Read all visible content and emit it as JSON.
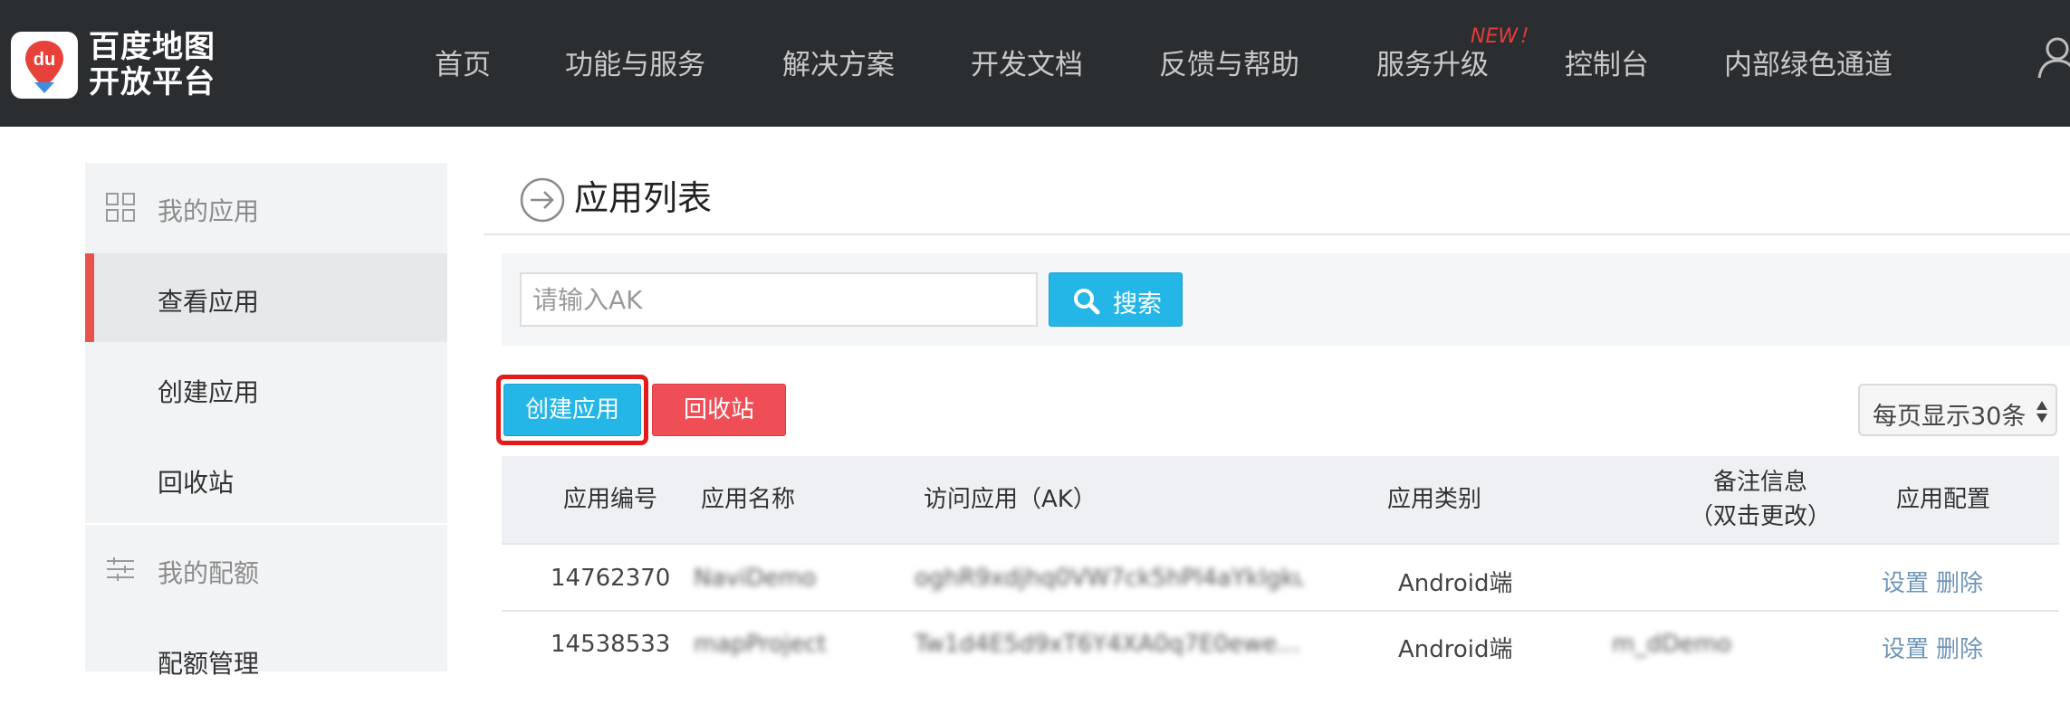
{
  "header": {
    "logo_line1": "百度地图",
    "logo_line2": "开放平台",
    "logo_mark": "du",
    "nav": [
      {
        "label": "首页"
      },
      {
        "label": "功能与服务"
      },
      {
        "label": "解决方案"
      },
      {
        "label": "开发文档"
      },
      {
        "label": "反馈与帮助"
      },
      {
        "label": "服务升级"
      },
      {
        "label": "控制台"
      },
      {
        "label": "内部绿色通道"
      }
    ],
    "new_badge": "NEW！",
    "icons": {
      "user": "user-icon"
    }
  },
  "sidebar": {
    "groups": [
      {
        "label": "我的应用",
        "icon": "grid-icon",
        "items": [
          {
            "label": "查看应用",
            "active": true
          },
          {
            "label": "创建应用"
          },
          {
            "label": "回收站"
          }
        ]
      },
      {
        "label": "我的配额",
        "icon": "sliders-icon",
        "items": [
          {
            "label": "配额管理"
          }
        ]
      }
    ]
  },
  "main": {
    "title": "应用列表",
    "search": {
      "placeholder": "请输入AK",
      "value": "",
      "button_label": "搜索"
    },
    "buttons": {
      "create": "创建应用",
      "recycle": "回收站"
    },
    "page_size": "每页显示30条",
    "table": {
      "headers": [
        "应用编号",
        "应用名称",
        "访问应用（AK）",
        "应用类别",
        "备注信息\n（双击更改）",
        "应用配置"
      ],
      "header_note_line1": "备注信息",
      "header_note_line2": "（双击更改）",
      "rows": [
        {
          "id": "14762370",
          "name": "NaviDemo",
          "ak": "oghR9xdjhq0VW7ck5hPl4aYklgkuh…",
          "type": "Android端",
          "note": "",
          "actions": [
            "设置",
            "删除"
          ]
        },
        {
          "id": "14538533",
          "name": "mapProject",
          "ak": "Tw1d4E5d9xT6Y4XA0q7E0ewe…",
          "type": "Android端",
          "note": "m_dDemo",
          "actions": [
            "设置",
            "删除"
          ]
        }
      ]
    }
  },
  "colors": {
    "topbar": "#2b2e30",
    "accent_blue": "#25b6e8",
    "recycle_red": "#ef4e56",
    "highlight_red": "#e21b1b",
    "active_bar": "#e8524c",
    "link": "#6f95b8"
  }
}
